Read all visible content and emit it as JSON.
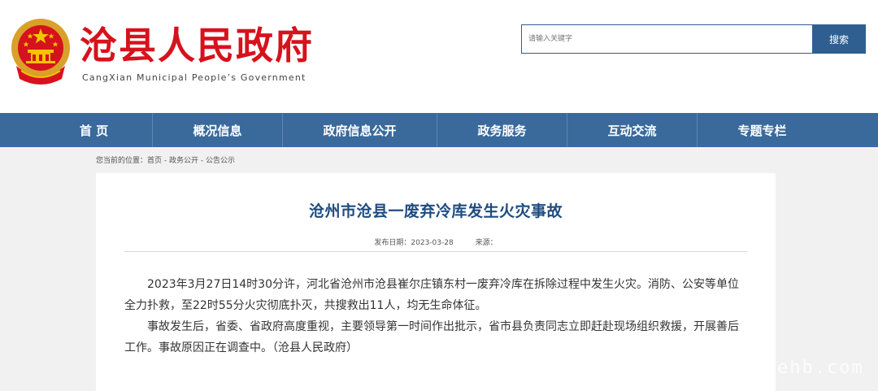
{
  "site": {
    "title": "沧县人民政府",
    "subtitle": "CangXian Municipal People’s Government"
  },
  "search": {
    "placeholder": "请输入关键字",
    "button_label": "搜索"
  },
  "nav": {
    "items": [
      {
        "label": "首 页"
      },
      {
        "label": "概况信息"
      },
      {
        "label": "政府信息公开"
      },
      {
        "label": "政务服务"
      },
      {
        "label": "互动交流"
      },
      {
        "label": "专题专栏"
      }
    ]
  },
  "breadcrumb": {
    "prefix": "您当前的位置：",
    "items": [
      "首页",
      "政务公开",
      "公告公示"
    ]
  },
  "article": {
    "title": "沧州市沧县一废弃冷库发生火灾事故",
    "publish_date": "发布日期：2023-03-28",
    "source": "来源：",
    "paragraphs": [
      "2023年3月27日14时30分许，河北省沧州市沧县崔尔庄镇东村一废弃冷库在拆除过程中发生火灾。消防、公安等单位全力扑救，至22时55分火灾彻底扑灭，共搜救出11人，均无生命体征。",
      "事故发生后，省委、省政府高度重视，主要领导第一时间作出批示，省市县负责同志立即赶赴现场组织救援，开展善后工作。事故原因正在调查中。（沧县人民政府）"
    ]
  },
  "watermark": "ehb.com",
  "colors": {
    "brand_red": "#d6121c",
    "nav_blue": "#3a6a9c",
    "title_blue": "#1e4c80"
  },
  "icons": {
    "emblem": "national-emblem-icon"
  }
}
